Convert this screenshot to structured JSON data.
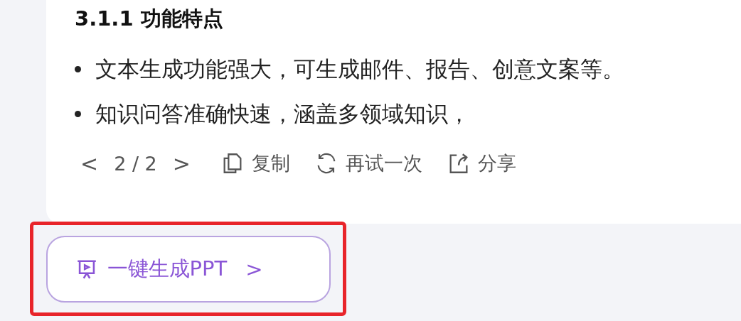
{
  "answer": {
    "heading": "3.1.1 功能特点",
    "bullets": [
      "文本生成功能强大，可生成邮件、报告、创意文案等。",
      "知识问答准确快速，涵盖多领域知识，"
    ],
    "pager": {
      "prev": "<",
      "text": "2 / 2",
      "next": ">"
    },
    "actions": [
      {
        "kind": "copy",
        "label": "复制"
      },
      {
        "kind": "retry",
        "label": "再试一次"
      },
      {
        "kind": "share",
        "label": "分享"
      }
    ]
  },
  "ppt_button": {
    "label": "一键生成PPT",
    "chevron": ">",
    "highlighted": true
  }
}
